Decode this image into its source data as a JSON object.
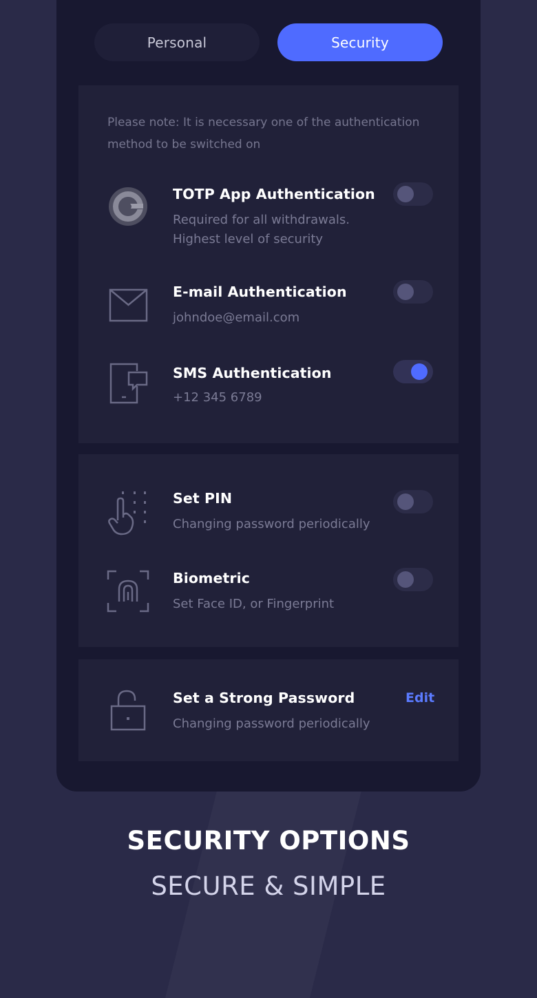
{
  "tabs": {
    "personal": "Personal",
    "security": "Security"
  },
  "auth_section": {
    "note": "Please note: It is necessary one of the authentication method to be switched on",
    "items": [
      {
        "icon": "google-authenticator-icon",
        "title": "TOTP App Authentication",
        "sub1": "Required for all withdrawals.",
        "sub2": "Highest level of security",
        "enabled": false
      },
      {
        "icon": "envelope-icon",
        "title": "E-mail Authentication",
        "sub1": "johndoe@email.com",
        "enabled": false
      },
      {
        "icon": "phone-message-icon",
        "title": "SMS Authentication",
        "sub1": "+12 345 6789",
        "enabled": true
      }
    ]
  },
  "lock_section": {
    "items": [
      {
        "icon": "pin-pad-icon",
        "title": "Set PIN",
        "sub1": "Changing password periodically",
        "enabled": false
      },
      {
        "icon": "fingerprint-scan-icon",
        "title": "Biometric",
        "sub1": "Set Face ID, or Fingerprint",
        "enabled": false
      }
    ]
  },
  "password_section": {
    "icon": "unlocked-padlock-icon",
    "title": "Set a Strong Password",
    "sub1": "Changing password periodically",
    "action": "Edit"
  },
  "promo": {
    "headline": "SECURITY OPTIONS",
    "subline": "SECURE & SIMPLE"
  },
  "colors": {
    "accent": "#4f6bff",
    "background": "#2a2a48",
    "panel": "#181830",
    "card": "#212139"
  }
}
